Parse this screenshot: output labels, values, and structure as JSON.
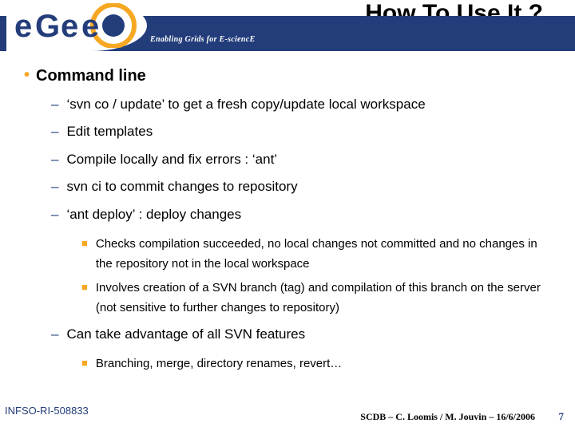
{
  "header": {
    "title": "How To Use It ?",
    "tagline": "Enabling Grids for E-sciencE",
    "logo_text": "eGee"
  },
  "content": {
    "l1": "Command line",
    "items": [
      {
        "text": "‘svn co / update’ to get a fresh copy/update local workspace"
      },
      {
        "text": "Edit templates"
      },
      {
        "text": "Compile locally and fix errors : ‘ant’"
      },
      {
        "text": "svn ci to commit changes to repository"
      },
      {
        "text": "‘ant deploy’ : deploy changes",
        "sub": [
          "Checks compilation succeeded, no local changes not committed and no changes in the repository not in the local workspace",
          "Involves creation of a SVN branch (tag) and compilation of this branch on the server (not sensitive to further changes to repository)"
        ]
      },
      {
        "text": "Can take advantage of all SVN features",
        "sub": [
          "Branching, merge, directory renames, revert…"
        ]
      }
    ]
  },
  "footer": {
    "left": "INFSO-RI-508833",
    "right": "SCDB – C. Loomis / M. Jouvin – 16/6/2006",
    "page": "7"
  }
}
